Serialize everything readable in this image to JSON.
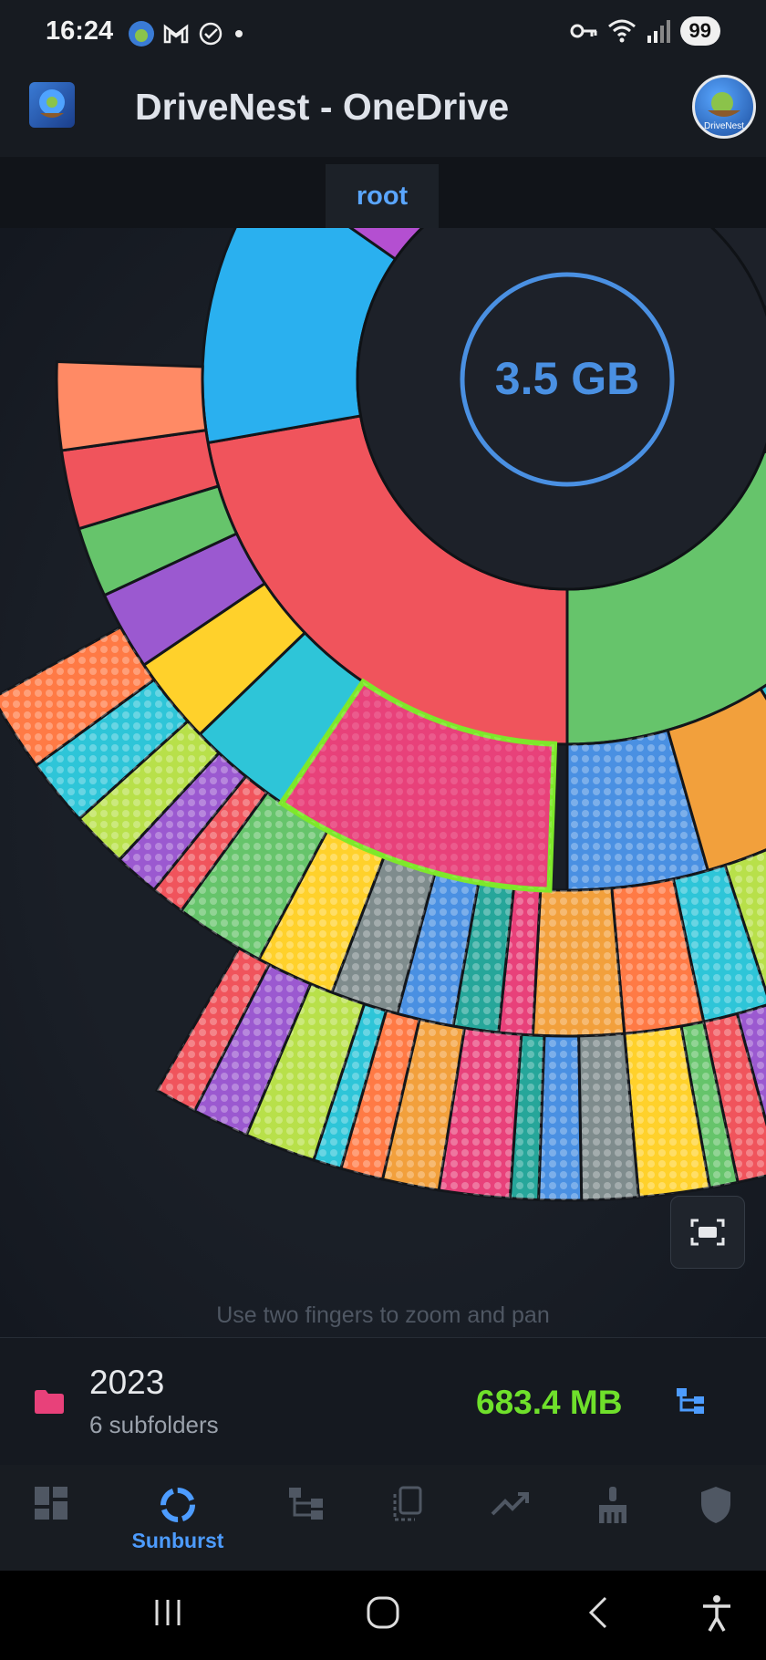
{
  "status_bar": {
    "time": "16:24",
    "left_icons": [
      "drivenest-app-icon",
      "gmail-icon",
      "check-circle-icon",
      "dot-icon"
    ],
    "right_icons": [
      "vpn-key-icon",
      "wifi-icon",
      "signal-icon"
    ],
    "battery": "99"
  },
  "app_bar": {
    "title": "DriveNest - OneDrive",
    "logo_icon": "drivenest-logo-icon",
    "avatar_label": "DriveNest"
  },
  "breadcrumb": {
    "items": [
      "root"
    ]
  },
  "chart": {
    "type": "sunburst",
    "center_total": "3.5 GB",
    "selected_segment": "2023",
    "selected_color": "#e8417a",
    "selected_outline_color": "#7ee82a",
    "center_ring_color": "#4a90e2"
  },
  "fit_button": {
    "icon": "fit-screen-icon"
  },
  "hint": "Use two fingers to zoom and pan",
  "selection_info": {
    "folder_icon": "folder-icon",
    "name": "2023",
    "subtitle": "6 subfolders",
    "size": "683.4 MB",
    "size_color": "#6fe02b",
    "action_icon": "tree-view-icon"
  },
  "bottom_nav": {
    "items": [
      {
        "icon": "dashboard-icon",
        "label": ""
      },
      {
        "icon": "sunburst-icon",
        "label": "Sunburst",
        "active": true
      },
      {
        "icon": "tree-icon",
        "label": ""
      },
      {
        "icon": "duplicates-icon",
        "label": ""
      },
      {
        "icon": "trending-icon",
        "label": ""
      },
      {
        "icon": "cleanup-brush-icon",
        "label": ""
      },
      {
        "icon": "shield-icon",
        "label": ""
      }
    ],
    "active_color": "#4d9cff"
  },
  "system_nav": {
    "icons": [
      "recents-icon",
      "home-icon",
      "back-icon",
      "accessibility-icon"
    ]
  }
}
